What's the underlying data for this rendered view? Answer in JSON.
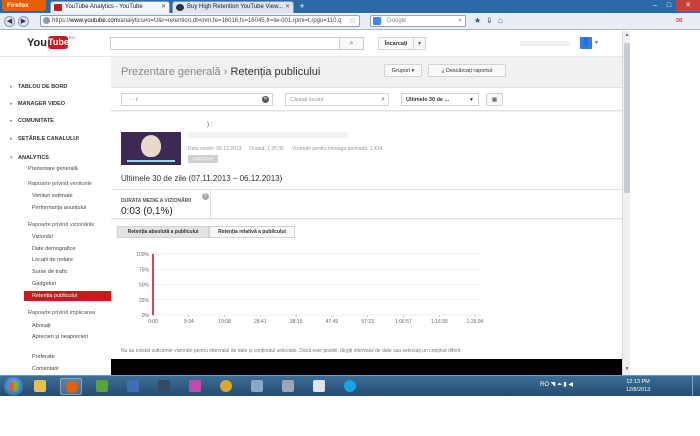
{
  "browser": {
    "menu_label": "Firefox",
    "tabs": [
      {
        "title": "YouTube Analytics - YouTube",
        "active": true
      },
      {
        "title": "Buy High Retention YouTube View...",
        "active": false
      }
    ],
    "new_tab": "+",
    "url_domain": "www.youtube.com",
    "url_rest": "/analytics#o=U&r=retention,dt=mm,fe=16016,fs=16045,fr=lw-001,rpmi=t,rpgu=110,q",
    "url_prefix": "https://",
    "search_placeholder": "Google",
    "window_controls": [
      "–",
      "□",
      "✕"
    ]
  },
  "youtube": {
    "logo_you": "You",
    "logo_tube": "Tube",
    "logo_region": "RO",
    "upload_label": "Încarcați",
    "avatar_glyph": "👤"
  },
  "sidebar": {
    "sections": [
      {
        "label": "TABLOU DE BORD"
      },
      {
        "label": "MANAGER VIDEO"
      },
      {
        "label": "COMUNITATE"
      },
      {
        "label": "SETĂRILE CANALULUI"
      },
      {
        "label": "ANALYTICS"
      }
    ],
    "overview": "Prezentare generală",
    "groups": [
      {
        "label": "Rapoarte privind veniturile",
        "items": [
          "Venituri estimate",
          "Performanța anunțului"
        ]
      },
      {
        "label": "Rapoarte privind vizionările",
        "items": [
          "Vizionări",
          "Date demografice",
          "Locații de redare",
          "Surse de trafic",
          "Gadgeturi",
          "Retenția publicului"
        ]
      },
      {
        "label": "Rapoarte privind implicarea",
        "items": [
          "Abonați",
          "Aprecieri și neaprecieri",
          "Preferate",
          "Comentarii"
        ]
      }
    ],
    "active_item": "Retenția publicului"
  },
  "main": {
    "breadcrumb_parent": "Prezentare generală",
    "breadcrumb_sep": " › ",
    "breadcrumb_current": "Retenția publicului",
    "groups_button": "Grupuri",
    "export_button": "Descărcați raportul",
    "filter_value": "·        ·              ·       /",
    "location_placeholder": "Căutați locații",
    "period_select": "Ultimele 30 de ...",
    "video": {
      "title_fragment": ") :",
      "created": "Data creării: 06.12.2013",
      "duration": "Durată: 1:35:36",
      "views_label": "Vizionări pentru întreaga perioadă: 1.434",
      "badge": "VIDEOCLIP"
    },
    "date_range": "Ultimele 30 de zile (07.11.2013 – 06.12.2013)",
    "metric": {
      "label": "DURATA MEDIE A VIZIONĂRII",
      "value": "0:03 (0,1%)",
      "help": "?"
    },
    "chart_tabs": [
      "Retenția absolută a publicului",
      "Retenția relativă a publicului"
    ],
    "note": "Nu au existat suficiente vizionări pentru intervalul de date și conținutul selectate. Dacă este posibil, lărgiți intervalul de date sau selectați un conținut diferit."
  },
  "chart_data": {
    "type": "line",
    "title": "",
    "xlabel": "",
    "ylabel": "",
    "x_ticks": [
      "0:00",
      "9:34",
      "19:08",
      "28:41",
      "38:15",
      "47:49",
      "57:23",
      "1:06:57",
      "1:16:30",
      "1:26:04"
    ],
    "y_ticks": [
      "100%",
      "75%",
      "50%",
      "25%",
      "0%"
    ],
    "ylim": [
      0,
      100
    ],
    "grid": true,
    "series": [
      {
        "values": [
          [
            0,
            100
          ],
          [
            0,
            0
          ]
        ]
      }
    ],
    "colors": {
      "line": "#cc181e",
      "grid": "#e0e0e0"
    }
  },
  "taskbar": {
    "apps": [
      {
        "icon": "folder-icon",
        "color": "#e8c050"
      },
      {
        "icon": "firefox-icon",
        "color": "#e66000",
        "active": true
      },
      {
        "icon": "utorrent-icon",
        "color": "#5aa23a"
      },
      {
        "icon": "app-blue-icon",
        "color": "#3a6fb8"
      },
      {
        "icon": "app-dark-icon",
        "color": "#354a64"
      },
      {
        "icon": "multicolor-app-icon",
        "color": "#c04ab0"
      },
      {
        "icon": "chrome-icon",
        "color": "#d9a82a"
      },
      {
        "icon": "paint-icon",
        "color": "#8aa8c8"
      },
      {
        "icon": "app-gray-icon",
        "color": "#9aa6b4"
      },
      {
        "icon": "document-icon",
        "color": "#dfe5ec"
      },
      {
        "icon": "skype-icon",
        "color": "#16a4e8"
      }
    ],
    "tray_text": "RO  ◥  ⏶  ▮  ◀",
    "time": "12:13 PM",
    "date": "12/8/2013"
  }
}
